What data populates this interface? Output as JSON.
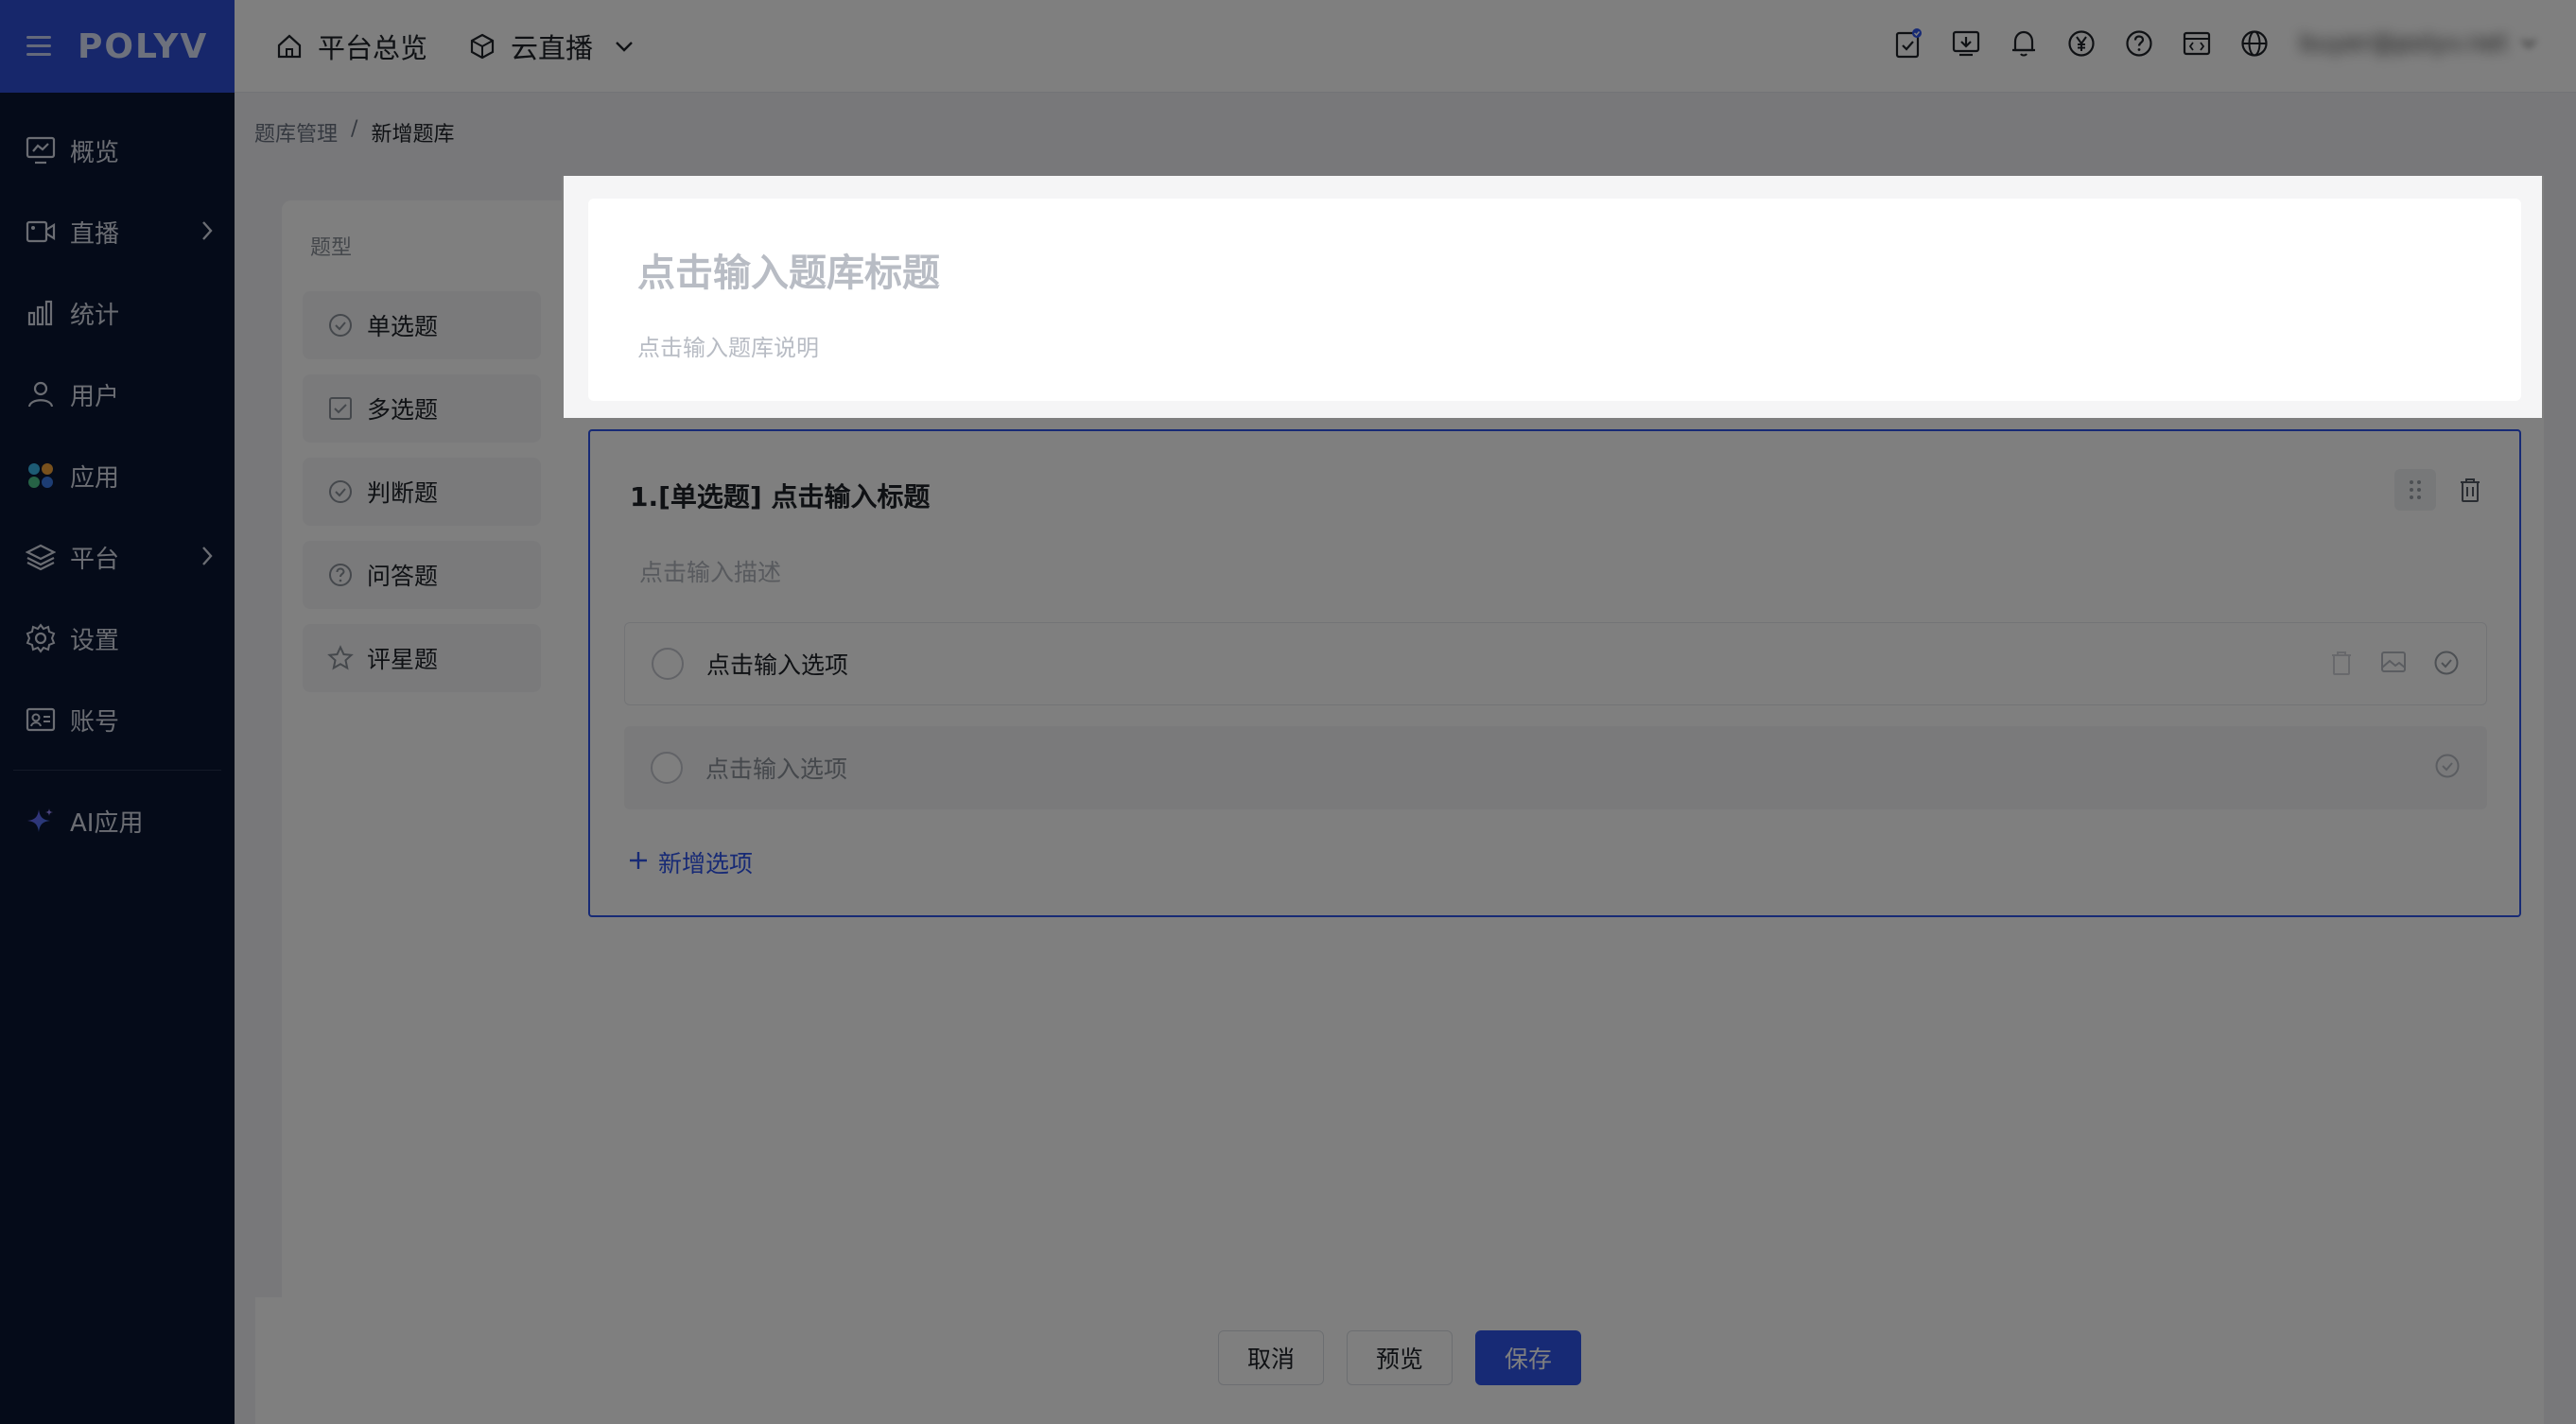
{
  "brand": {
    "logo": "POLYV"
  },
  "sidebar": {
    "items": [
      {
        "label": "概览",
        "icon": "monitor-chart-icon",
        "has_arrow": false
      },
      {
        "label": "直播",
        "icon": "video-camera-icon",
        "has_arrow": true
      },
      {
        "label": "统计",
        "icon": "bar-chart-icon",
        "has_arrow": false
      },
      {
        "label": "用户",
        "icon": "user-icon",
        "has_arrow": false
      },
      {
        "label": "应用",
        "icon": "apps-grid-icon",
        "has_arrow": false
      },
      {
        "label": "平台",
        "icon": "layers-icon",
        "has_arrow": true
      },
      {
        "label": "设置",
        "icon": "gear-icon",
        "has_arrow": false
      },
      {
        "label": "账号",
        "icon": "id-card-icon",
        "has_arrow": false
      }
    ],
    "ai_item": {
      "label": "AI应用",
      "icon": "sparkle-icon"
    }
  },
  "topbar": {
    "home_label": "平台总览",
    "product_label": "云直播",
    "user_email": "buyer@polyv.net",
    "icons": [
      "task-check-icon",
      "download-icon",
      "bell-icon",
      "yen-icon",
      "help-icon",
      "code-window-icon",
      "globe-icon"
    ]
  },
  "breadcrumb": {
    "parent": "题库管理",
    "separator": "/",
    "current": "新增题库"
  },
  "types_panel": {
    "label": "题型",
    "items": [
      {
        "label": "单选题",
        "icon": "radio-check-icon"
      },
      {
        "label": "多选题",
        "icon": "checkbox-icon"
      },
      {
        "label": "判断题",
        "icon": "judge-check-icon"
      },
      {
        "label": "问答题",
        "icon": "question-icon"
      },
      {
        "label": "评星题",
        "icon": "star-icon"
      }
    ]
  },
  "header_card": {
    "title_placeholder": "点击输入题库标题",
    "desc_placeholder": "点击输入题库说明"
  },
  "question": {
    "title": "1.[单选题] 点击输入标题",
    "desc_placeholder": "点击输入描述",
    "options": [
      {
        "label": "点击输入选项",
        "filled": true
      },
      {
        "label": "点击输入选项",
        "filled": false
      }
    ],
    "add_option": "新增选项"
  },
  "footer": {
    "cancel": "取消",
    "preview": "预览",
    "save": "保存"
  },
  "colors": {
    "primary": "#2f54eb",
    "sidebar": "#0a1633",
    "brand": "#2f4fd6"
  }
}
